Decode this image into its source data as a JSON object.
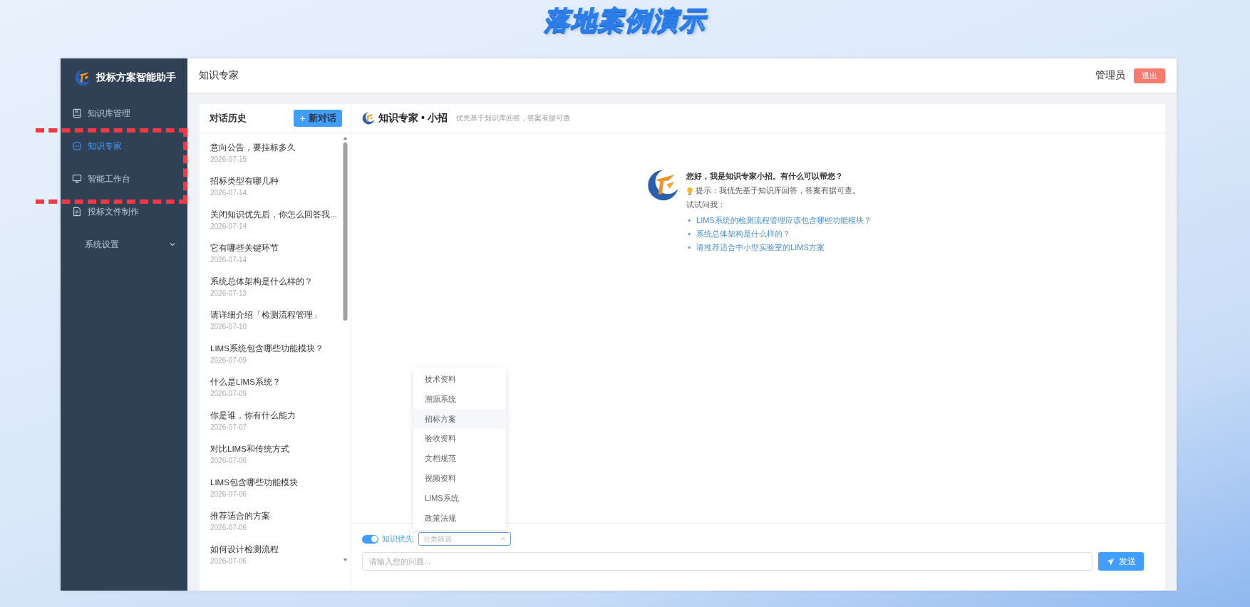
{
  "banner": {
    "title": "落地案例演示"
  },
  "sidebar": {
    "app_name": "投标方案智能助手",
    "items": [
      {
        "label": "知识库管理",
        "kind": "link",
        "selected": false
      },
      {
        "label": "知识专家",
        "kind": "link",
        "selected": true
      },
      {
        "label": "智能工作台",
        "kind": "link",
        "selected": false
      },
      {
        "label": "投标文件制作",
        "kind": "link",
        "selected": false
      },
      {
        "label": "系统设置",
        "kind": "submenu",
        "expanded": false,
        "selected": false
      }
    ]
  },
  "topbar": {
    "title": "知识专家",
    "user": "管理员",
    "logout": "退出"
  },
  "history": {
    "title": "对话历史",
    "new_button": "新对话",
    "items": [
      {
        "title": "意向公告，要挂标多久",
        "date": "2026-07-15"
      },
      {
        "title": "招标类型有哪几种",
        "date": "2026-07-14"
      },
      {
        "title": "关闭知识优先后，你怎么回答我...",
        "date": "2026-07-14"
      },
      {
        "title": "它有哪些关键环节",
        "date": "2026-07-14"
      },
      {
        "title": "系统总体架构是什么样的？",
        "date": "2026-07-13"
      },
      {
        "title": "请详细介绍「检测流程管理」",
        "date": "2026-07-10"
      },
      {
        "title": "LIMS系统包含哪些功能模块？",
        "date": "2026-07-09"
      },
      {
        "title": "什么是LIMS系统？",
        "date": "2026-07-09"
      },
      {
        "title": "你是谁，你有什么能力",
        "date": "2026-07-07"
      },
      {
        "title": "对比LIMS和传统方式",
        "date": "2026-07-06"
      },
      {
        "title": "LIMS包含哪些功能模块",
        "date": "2026-07-06"
      },
      {
        "title": "推荐适合的方案",
        "date": "2026-07-06"
      },
      {
        "title": "如何设计检测流程",
        "date": "2026-07-06"
      }
    ]
  },
  "chat": {
    "title": "知识专家 • 小招",
    "subtitle": "优先基于知识库回答，答案有据可查",
    "greeting": "您好，我是知识专家小招。有什么可以帮您？",
    "tip": "提示：我优先基于知识库回答，答案有据可查。",
    "try_label": "试试问我：",
    "suggestions": [
      {
        "bullet": "•",
        "text": "LIMS系统的检测流程管理应该包含哪些功能模块？"
      },
      {
        "bullet": "•",
        "text": "系统总体架构是什么样的？"
      },
      {
        "bullet": "•",
        "text": "请推荐适合中小型实验室的LIMS方案"
      }
    ]
  },
  "composer": {
    "knowledge_first": {
      "label": "知识优先",
      "on": true
    },
    "category": {
      "placeholder": "分类筛选",
      "expanded": true,
      "options": [
        {
          "label": "技术资料",
          "highlighted": false
        },
        {
          "label": "溯源系统",
          "highlighted": false
        },
        {
          "label": "招标方案",
          "highlighted": true
        },
        {
          "label": "验收资料",
          "highlighted": false
        },
        {
          "label": "文档规范",
          "highlighted": false
        },
        {
          "label": "视频资料",
          "highlighted": false
        },
        {
          "label": "LIMS系统",
          "highlighted": false
        },
        {
          "label": "政策法规",
          "highlighted": false
        }
      ]
    },
    "input": {
      "placeholder": "请输入您的问题..."
    },
    "send": "发送"
  }
}
